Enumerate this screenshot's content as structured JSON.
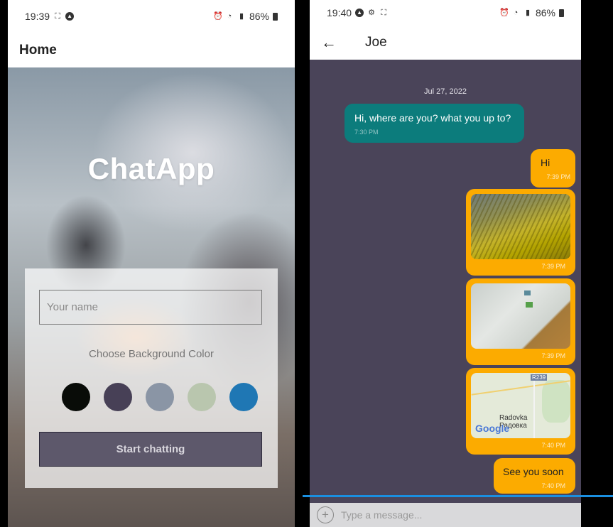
{
  "left_screen": {
    "status": {
      "time": "19:39",
      "battery": "86%",
      "icons": [
        "screenshot-icon",
        "autoplay-icon"
      ]
    },
    "header": {
      "title": "Home"
    },
    "app_title": "ChatApp",
    "login": {
      "name_placeholder": "Your name",
      "choose_label": "Choose Background Color",
      "colors": [
        "#090c08",
        "#474056",
        "#8a95a5",
        "#b9c6ae",
        "#1f77b4"
      ],
      "start_label": "Start chatting"
    }
  },
  "right_screen": {
    "status": {
      "time": "19:40",
      "battery": "86%"
    },
    "header": {
      "contact": "Joe",
      "back_icon": "arrow-left-icon"
    },
    "date_label": "Jul 27, 2022",
    "messages": [
      {
        "side": "left",
        "type": "text",
        "text": "Hi, where are you? what you up to?",
        "time": "7:30 PM"
      },
      {
        "side": "right",
        "type": "text",
        "text": "Hi",
        "time": "7:39 PM"
      },
      {
        "side": "right",
        "type": "image",
        "image": "photo-water",
        "time": "7:39 PM"
      },
      {
        "side": "right",
        "type": "image",
        "image": "photo-laptop",
        "time": "7:39 PM"
      },
      {
        "side": "right",
        "type": "location",
        "map": {
          "road_label": "R239",
          "place": "Radovka",
          "place_alt": "Радовка",
          "brand": "Google"
        },
        "time": "7:40 PM"
      },
      {
        "side": "right",
        "type": "text",
        "text": "See you soon",
        "time": "7:40 PM"
      }
    ],
    "composer": {
      "placeholder": "Type a message..."
    }
  },
  "colors": {
    "teal_bubble": "#0c7c7c",
    "orange_bubble": "#fcab00",
    "chat_bg": "#4a4459",
    "accent_line": "#1a8fe0"
  }
}
